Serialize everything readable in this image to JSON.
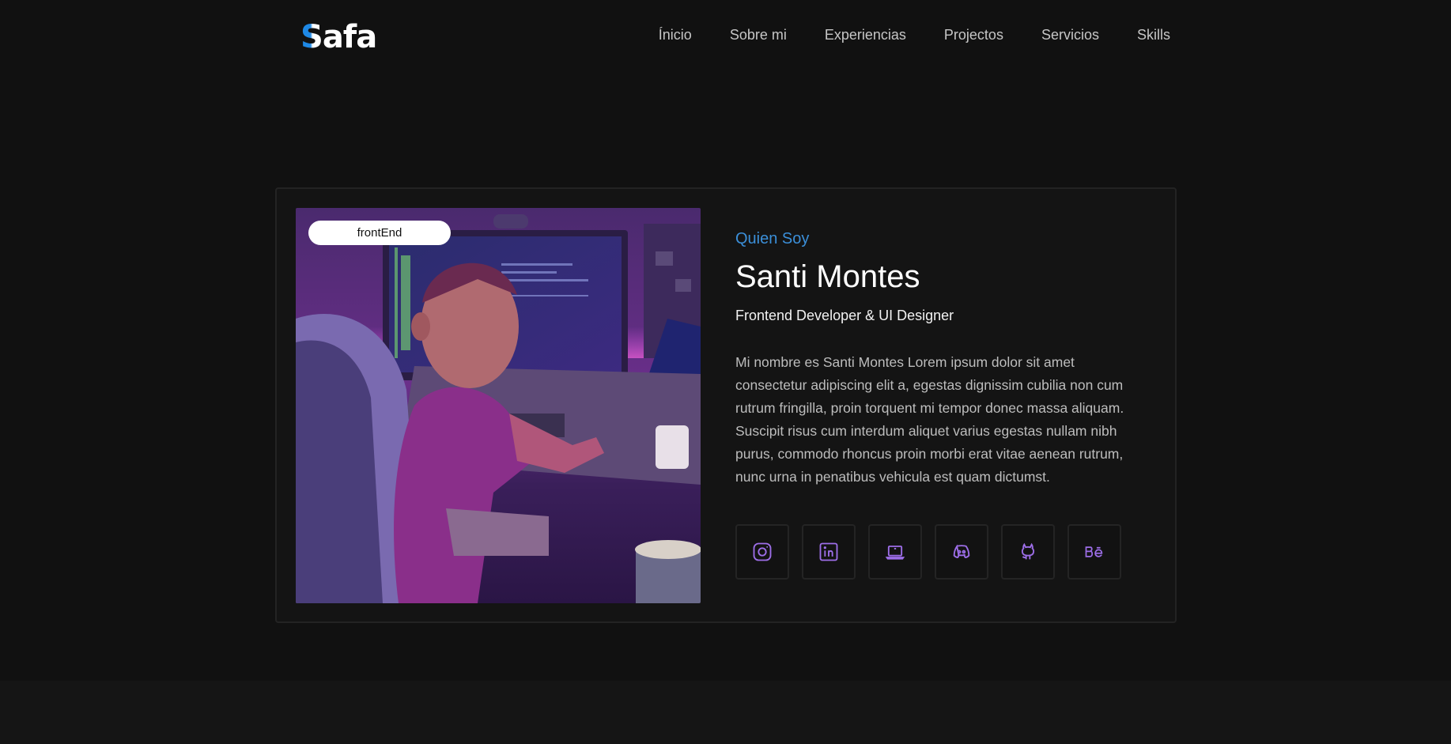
{
  "brand": {
    "logo_first": "S",
    "logo_rest": "afa"
  },
  "nav": [
    {
      "label": "Ínicio"
    },
    {
      "label": "Sobre mi"
    },
    {
      "label": "Experiencias"
    },
    {
      "label": "Projectos"
    },
    {
      "label": "Servicios"
    },
    {
      "label": "Skills"
    }
  ],
  "profile": {
    "tag": "frontEnd",
    "kicker": "Quien Soy",
    "name": "Santi Montes",
    "role": "Frontend Developer & UI Designer",
    "bio": "Mi nombre es Santi Montes Lorem ipsum dolor sit amet consectetur adipiscing elit a, egestas dignissim cubilia non cum rutrum fringilla, proin torquent mi tempor donec massa aliquam. Suscipit risus cum interdum aliquet varius egestas nullam nibh purus, commodo rhoncus proin morbi erat vitae aenean rutrum, nunc urna in penatibus vehicula est quam dictumst."
  },
  "socials": [
    {
      "icon": "instagram-icon"
    },
    {
      "icon": "linkedin-icon"
    },
    {
      "icon": "laptop-icon"
    },
    {
      "icon": "discord-icon"
    },
    {
      "icon": "github-icon"
    },
    {
      "icon": "behance-icon"
    }
  ],
  "colors": {
    "background": "#111111",
    "accent": "#3b8fd9",
    "icon": "#9d6ee8"
  }
}
